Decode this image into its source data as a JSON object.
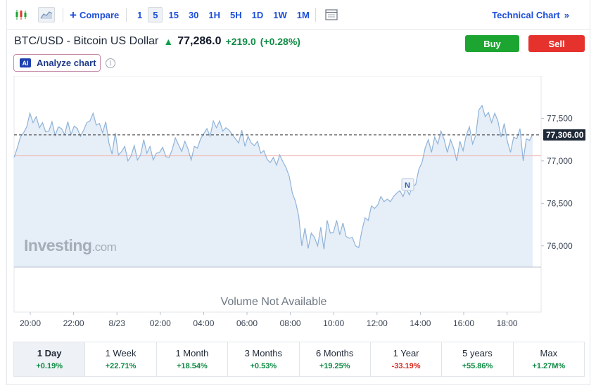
{
  "toolbar": {
    "compare_label": "Compare",
    "intervals": [
      "1",
      "5",
      "15",
      "30",
      "1H",
      "5H",
      "1D",
      "1W",
      "1M"
    ],
    "active_interval": "5",
    "technical_chart_label": "Technical Chart",
    "technical_chart_arrow": "»"
  },
  "header": {
    "asset_name": "BTC/USD - Bitcoin US Dollar",
    "price": "77,286.0",
    "change": "+219.0",
    "change_pct": "(+0.28%)",
    "buy_label": "Buy",
    "sell_label": "Sell",
    "analyze_badge": "AI",
    "analyze_label": "Analyze chart",
    "info_glyph": "i"
  },
  "colors": {
    "accent": "#1d4ed8",
    "buy": "#1da532",
    "sell": "#e5322d",
    "line": "#8fb3d9",
    "fill": "#e6eef7",
    "positive": "#0e8a43",
    "negative": "#d9281e"
  },
  "chart": {
    "watermark_brand": "Investing",
    "watermark_suffix": ".com",
    "volume_text": "Volume Not Available",
    "current_price_label": "77,306.00"
  },
  "chart_data": {
    "type": "area",
    "y_range": [
      75750,
      77900
    ],
    "y_ticks": [
      "77,500",
      "77,000",
      "76,500",
      "76,000"
    ],
    "y_tick_values": [
      77500,
      77000,
      76500,
      76000
    ],
    "x_tick_labels": [
      "20:00",
      "22:00",
      "8/23",
      "02:00",
      "04:00",
      "06:00",
      "08:00",
      "10:00",
      "12:00",
      "14:00",
      "16:00",
      "18:00"
    ],
    "current_price": 77306,
    "reference_price": 77060,
    "annotation": "N",
    "annotation_x_step": 23,
    "series_values": [
      77040,
      77150,
      77280,
      77330,
      77400,
      77560,
      77450,
      77520,
      77390,
      77450,
      77340,
      77350,
      77460,
      77300,
      77400,
      77380,
      77310,
      77460,
      77310,
      77410,
      77380,
      77290,
      77360,
      77450,
      77470,
      77560,
      77420,
      77440,
      77330,
      77460,
      77210,
      77080,
      77330,
      77070,
      77110,
      77170,
      77000,
      77060,
      77180,
      77010,
      77070,
      77250,
      77090,
      77170,
      77010,
      77090,
      77100,
      77160,
      77050,
      77040,
      77130,
      77270,
      77190,
      77110,
      77230,
      77140,
      77010,
      77170,
      77150,
      77260,
      77320,
      77380,
      77290,
      77470,
      77390,
      77470,
      77350,
      77390,
      77360,
      77310,
      77260,
      77210,
      77360,
      77170,
      77290,
      77210,
      77180,
      77230,
      77090,
      77120,
      77020,
      76980,
      77040,
      76950,
      77070,
      76990,
      76920,
      76820,
      76620,
      76520,
      76350,
      76000,
      76210,
      75970,
      76150,
      76100,
      76000,
      76220,
      75960,
      76300,
      76150,
      76160,
      76300,
      76130,
      76270,
      76110,
      76090,
      76100,
      76000,
      75980,
      76180,
      76330,
      76300,
      76470,
      76440,
      76480,
      76580,
      76520,
      76550,
      76520,
      76580,
      76620,
      76650,
      76580,
      76680,
      76600,
      76700,
      76720,
      76900,
      76980,
      77150,
      77250,
      77100,
      77280,
      77200,
      77350,
      77250,
      77100,
      77250,
      77150,
      77000,
      77230,
      77120,
      77300,
      77400,
      77200,
      77300,
      77600,
      77650,
      77520,
      77570,
      77450,
      77560,
      77470,
      77280,
      77440,
      77230,
      77100,
      77280,
      77260,
      77380,
      77000,
      77260,
      77240,
      77310
    ]
  },
  "periods": [
    {
      "label": "1 Day",
      "change": "+0.19%",
      "positive": true,
      "active": true
    },
    {
      "label": "1 Week",
      "change": "+22.71%",
      "positive": true,
      "active": false
    },
    {
      "label": "1 Month",
      "change": "+18.54%",
      "positive": true,
      "active": false
    },
    {
      "label": "3 Months",
      "change": "+0.53%",
      "positive": true,
      "active": false
    },
    {
      "label": "6 Months",
      "change": "+19.25%",
      "positive": true,
      "active": false
    },
    {
      "label": "1 Year",
      "change": "-33.19%",
      "positive": false,
      "active": false
    },
    {
      "label": "5 years",
      "change": "+55.86%",
      "positive": true,
      "active": false
    },
    {
      "label": "Max",
      "change": "+1.27M%",
      "positive": true,
      "active": false
    }
  ]
}
